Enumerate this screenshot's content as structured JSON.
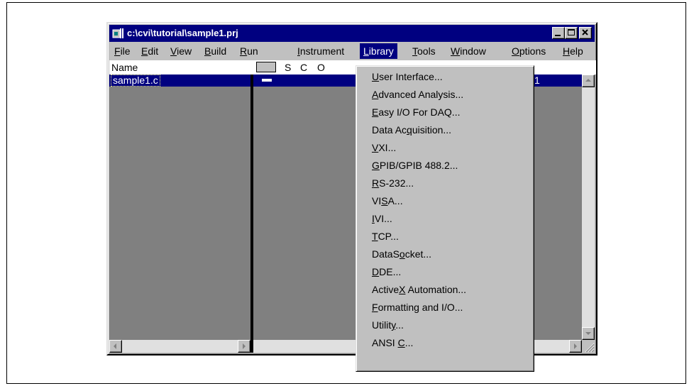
{
  "window": {
    "title": "c:\\cvi\\tutorial\\sample1.prj"
  },
  "menubar": {
    "items": [
      {
        "pre": "",
        "key": "F",
        "post": "ile"
      },
      {
        "pre": "",
        "key": "E",
        "post": "dit"
      },
      {
        "pre": "",
        "key": "V",
        "post": "iew"
      },
      {
        "pre": "",
        "key": "B",
        "post": "uild"
      },
      {
        "pre": "",
        "key": "R",
        "post": "un"
      },
      {
        "pre": "",
        "key": "I",
        "post": "nstrument"
      },
      {
        "pre": "",
        "key": "L",
        "post": "ibrary"
      },
      {
        "pre": "",
        "key": "T",
        "post": "ools"
      },
      {
        "pre": "",
        "key": "W",
        "post": "indow"
      },
      {
        "pre": "",
        "key": "O",
        "post": "ptions"
      },
      {
        "pre": "",
        "key": "H",
        "post": "elp"
      }
    ]
  },
  "file_list": {
    "header": {
      "name": "Name",
      "col_s": "S",
      "col_c": "C",
      "col_o": "O"
    },
    "rows": [
      {
        "name": "sample1.c",
        "number": "1"
      }
    ]
  },
  "library_menu": {
    "items": [
      {
        "pre": "",
        "key": "U",
        "post": "ser Interface..."
      },
      {
        "pre": "",
        "key": "A",
        "post": "dvanced Analysis..."
      },
      {
        "pre": "",
        "key": "E",
        "post": "asy I/O For DAQ..."
      },
      {
        "pre": "Data Ac",
        "key": "q",
        "post": "uisition..."
      },
      {
        "pre": "",
        "key": "V",
        "post": "XI..."
      },
      {
        "pre": "",
        "key": "G",
        "post": "PIB/GPIB 488.2..."
      },
      {
        "pre": "",
        "key": "R",
        "post": "S-232..."
      },
      {
        "pre": "VI",
        "key": "S",
        "post": "A..."
      },
      {
        "pre": "",
        "key": "I",
        "post": "VI..."
      },
      {
        "pre": "",
        "key": "T",
        "post": "CP..."
      },
      {
        "pre": "DataS",
        "key": "o",
        "post": "cket..."
      },
      {
        "pre": "",
        "key": "D",
        "post": "DE..."
      },
      {
        "pre": "Active",
        "key": "X",
        "post": " Automation..."
      },
      {
        "pre": "",
        "key": "F",
        "post": "ormatting and I/O..."
      },
      {
        "pre": "Utilit",
        "key": "y",
        "post": "..."
      },
      {
        "pre": "ANSI ",
        "key": "C",
        "post": "..."
      }
    ]
  }
}
